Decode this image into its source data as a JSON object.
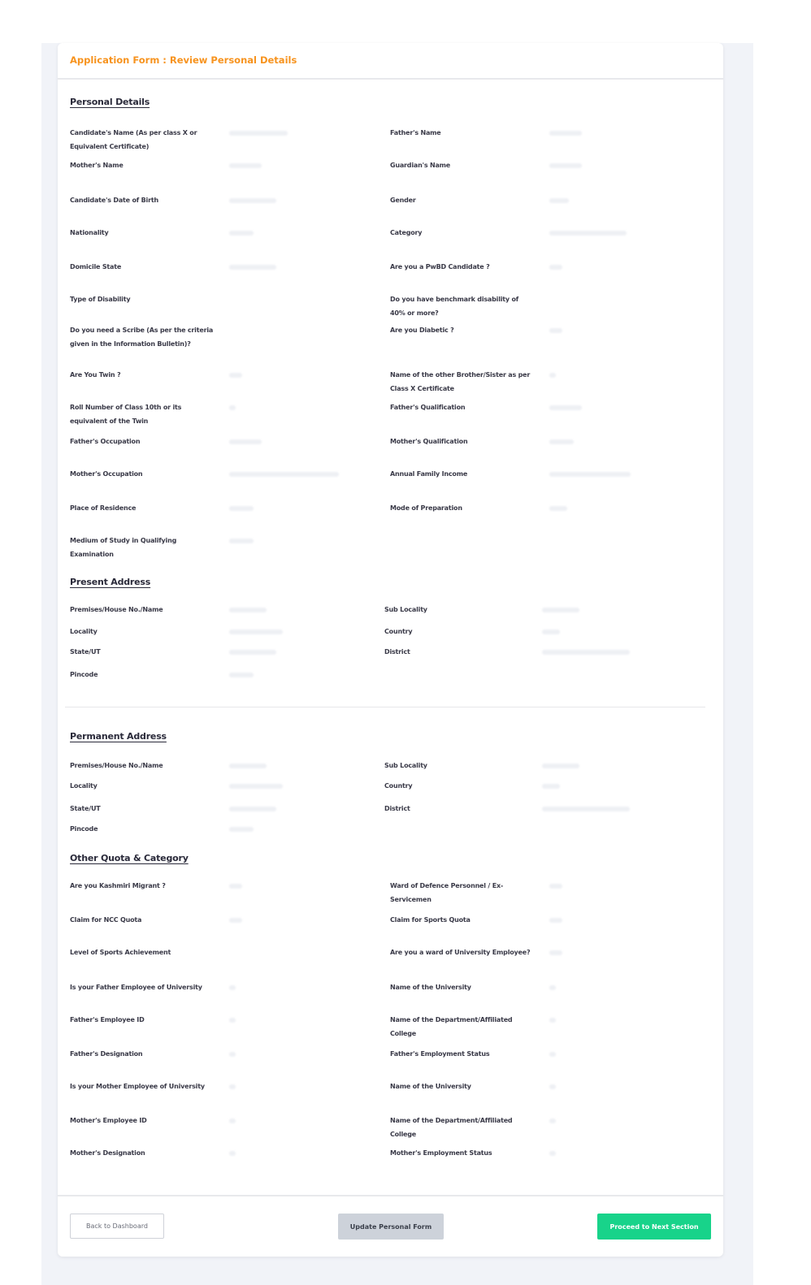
{
  "form": {
    "title": "Application Form : Review Personal Details"
  },
  "sections": {
    "personal": "Personal Details",
    "present_address": "Present Address",
    "permanent_address": "Permanent Address",
    "other_quota": "Other Quota & Category"
  },
  "personal": [
    "Candidate's Name (As per class X or Equivalent Certificate)",
    "Father's Name",
    "Mother's Name",
    "Guardian's Name",
    "Candidate's Date of Birth",
    "Gender",
    "Nationality",
    "Category",
    "Domicile State",
    "Are you a PwBD Candidate ?",
    "Type of Disability",
    "Do you have benchmark disability of 40% or more?",
    "Do you need a Scribe (As per the criteria given in the Information Bulletin)?",
    "Are you Diabetic ?",
    "Are You Twin ?",
    "Name of the other Brother/Sister as per Class X Certificate",
    "Roll Number of Class 10th or its equivalent of the Twin",
    "Father's Qualification",
    "Father's Occupation",
    "Mother's Qualification",
    "Mother's Occupation",
    "Annual Family Income",
    "Place of Residence",
    "Mode of Preparation",
    "Medium of Study in Qualifying Examination"
  ],
  "present": [
    "Premises/House No./Name",
    "Sub Locality",
    "Locality",
    "Country",
    "State/UT",
    "District",
    "Pincode"
  ],
  "permanent": [
    "Premises/House No./Name",
    "Sub Locality",
    "Locality",
    "Country",
    "State/UT",
    "District",
    "Pincode"
  ],
  "quota": [
    "Are you Kashmiri Migrant ?",
    "Ward of Defence Personnel / Ex-Servicemen",
    "Claim for NCC Quota",
    "Claim for Sports Quota",
    "Level of Sports Achievement",
    "Are you a ward of University Employee?",
    "Is your Father Employee of University",
    "Name of the University",
    "Father's Employee ID",
    "Name of the Department/Affiliated College",
    "Father's Designation",
    "Father's Employment Status",
    "Is your Mother Employee of University",
    "Name of the University",
    "Mother's Employee ID",
    "Name of the Department/Affiliated College",
    "Mother's Designation",
    "Mother's Employment Status"
  ],
  "buttons": {
    "back": "Back to Dashboard",
    "update": "Update Personal Form",
    "next": "Proceed to Next Section"
  }
}
